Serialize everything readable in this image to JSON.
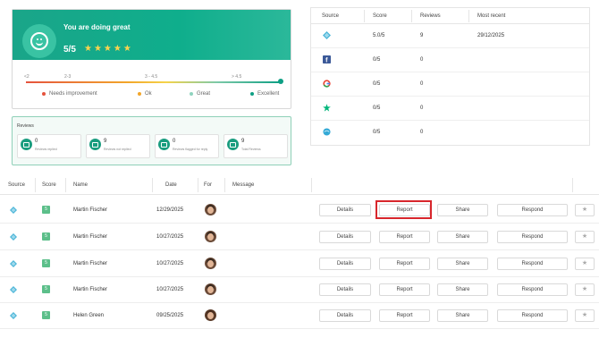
{
  "summary": {
    "title": "You are doing great",
    "score": "5/5",
    "stars": "★★★★★",
    "scale_ticks": [
      "<2",
      "2-3",
      "3 - 4.5",
      "> 4.5"
    ],
    "legend": [
      {
        "label": "Needs improvement",
        "color": "#e5533d"
      },
      {
        "label": "Ok",
        "color": "#f2a62a"
      },
      {
        "label": "Great",
        "color": "#8fd3be"
      },
      {
        "label": "Excellent",
        "color": "#0e9f84"
      }
    ]
  },
  "reviews_stats": {
    "title": "Reviews",
    "items": [
      {
        "value": "0",
        "label": "Reviews replied"
      },
      {
        "value": "9",
        "label": "Reviews not replied"
      },
      {
        "value": "0",
        "label": "Reviews flagged for reply"
      },
      {
        "value": "9",
        "label": "Total Reviews"
      }
    ]
  },
  "sources": {
    "headers": [
      "Source",
      "Score",
      "Reviews",
      "Most recent"
    ],
    "rows": [
      {
        "icon": "diamond-icon",
        "score": "5.0/5",
        "reviews": "9",
        "recent": "29/12/2025"
      },
      {
        "icon": "facebook-icon",
        "score": "0/5",
        "reviews": "0",
        "recent": ""
      },
      {
        "icon": "google-icon",
        "score": "0/5",
        "reviews": "0",
        "recent": ""
      },
      {
        "icon": "trustpilot-icon",
        "score": "0/5",
        "reviews": "0",
        "recent": ""
      },
      {
        "icon": "globe-icon",
        "score": "0/5",
        "reviews": "0",
        "recent": ""
      }
    ]
  },
  "reviews": {
    "headers": [
      "Source",
      "Score",
      "Name",
      "Date",
      "For",
      "Message"
    ],
    "actions": {
      "details": "Details",
      "report": "Report",
      "share": "Share",
      "respond": "Respond",
      "star": "★"
    },
    "rows": [
      {
        "score": "5",
        "name": "Martin Fischer",
        "date": "12/29/2025"
      },
      {
        "score": "5",
        "name": "Martin Fischer",
        "date": "10/27/2025"
      },
      {
        "score": "5",
        "name": "Martin Fischer",
        "date": "10/27/2025"
      },
      {
        "score": "5",
        "name": "Martin Fischer",
        "date": "10/27/2025"
      },
      {
        "score": "5",
        "name": "Helen Green",
        "date": "09/25/2025"
      }
    ]
  },
  "colors": {
    "brand": "#10a98a",
    "highlight": "#d8262c"
  }
}
